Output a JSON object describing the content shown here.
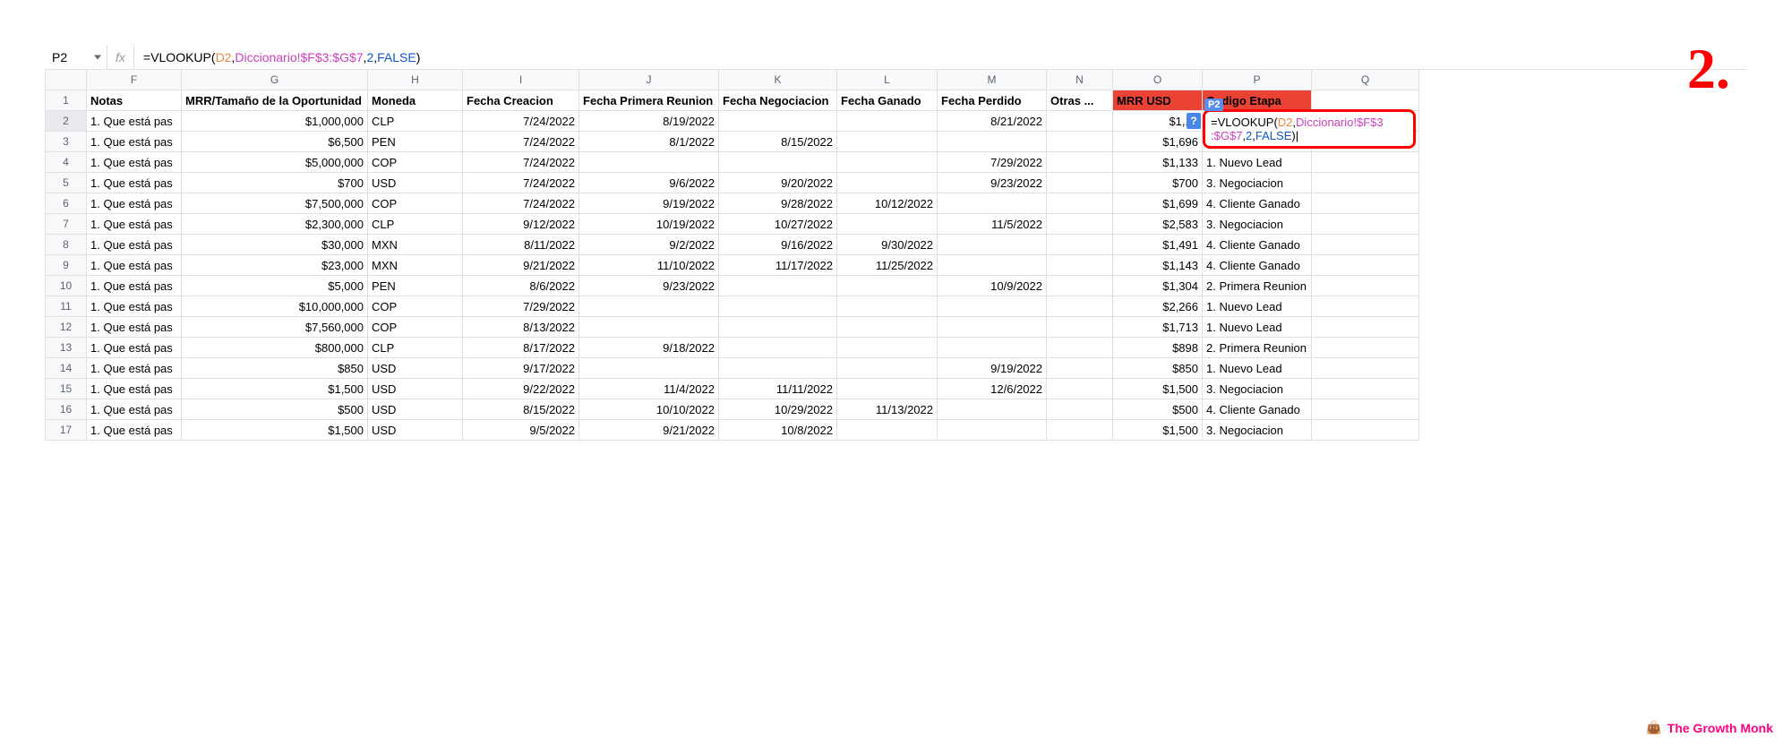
{
  "annotation": {
    "step_label": "2."
  },
  "name_box": {
    "value": "P2"
  },
  "formula_bar": {
    "fx": "fx",
    "parts": {
      "eq": "=",
      "fn": "VLOOKUP",
      "open": "(",
      "ref1": "D2",
      "c1": ",",
      "ref2": "Diccionario!$F$3:$G$7",
      "c2": ",",
      "num": "2",
      "c3": ",",
      "bool": "FALSE",
      "close": ")"
    }
  },
  "columns": [
    "F",
    "G",
    "H",
    "I",
    "J",
    "K",
    "L",
    "M",
    "N",
    "O",
    "P",
    "Q"
  ],
  "headers": {
    "F": "Notas",
    "G": "MRR/Tamaño de la Oportunidad",
    "H": "Moneda",
    "I": "Fecha Creacion",
    "J": "Fecha Primera Reunion",
    "K": "Fecha Negociacion",
    "L": "Fecha Ganado",
    "M": "Fecha Perdido",
    "N": "Otras ...",
    "O": "MRR USD",
    "P": "Codigo Etapa",
    "Q": ""
  },
  "rows": [
    {
      "r": 2,
      "F": "1. Que está pas",
      "G": "$1,000,000",
      "H": "CLP",
      "I": "7/24/2022",
      "J": "8/19/2022",
      "K": "",
      "L": "",
      "M": "8/21/2022",
      "N": "",
      "O": "$1,12",
      "P": ""
    },
    {
      "r": 3,
      "F": "1. Que está pas",
      "G": "$6,500",
      "H": "PEN",
      "I": "7/24/2022",
      "J": "8/1/2022",
      "K": "8/15/2022",
      "L": "",
      "M": "",
      "N": "",
      "O": "$1,696",
      "P": ""
    },
    {
      "r": 4,
      "F": "1. Que está pas",
      "G": "$5,000,000",
      "H": "COP",
      "I": "7/24/2022",
      "J": "",
      "K": "",
      "L": "",
      "M": "7/29/2022",
      "N": "",
      "O": "$1,133",
      "P": "1. Nuevo Lead"
    },
    {
      "r": 5,
      "F": "1. Que está pas",
      "G": "$700",
      "H": "USD",
      "I": "7/24/2022",
      "J": "9/6/2022",
      "K": "9/20/2022",
      "L": "",
      "M": "9/23/2022",
      "N": "",
      "O": "$700",
      "P": "3. Negociacion"
    },
    {
      "r": 6,
      "F": "1. Que está pas",
      "G": "$7,500,000",
      "H": "COP",
      "I": "7/24/2022",
      "J": "9/19/2022",
      "K": "9/28/2022",
      "L": "10/12/2022",
      "M": "",
      "N": "",
      "O": "$1,699",
      "P": "4. Cliente Ganado"
    },
    {
      "r": 7,
      "F": "1. Que está pas",
      "G": "$2,300,000",
      "H": "CLP",
      "I": "9/12/2022",
      "J": "10/19/2022",
      "K": "10/27/2022",
      "L": "",
      "M": "11/5/2022",
      "N": "",
      "O": "$2,583",
      "P": "3. Negociacion"
    },
    {
      "r": 8,
      "F": "1. Que está pas",
      "G": "$30,000",
      "H": "MXN",
      "I": "8/11/2022",
      "J": "9/2/2022",
      "K": "9/16/2022",
      "L": "9/30/2022",
      "M": "",
      "N": "",
      "O": "$1,491",
      "P": "4. Cliente Ganado"
    },
    {
      "r": 9,
      "F": "1. Que está pas",
      "G": "$23,000",
      "H": "MXN",
      "I": "9/21/2022",
      "J": "11/10/2022",
      "K": "11/17/2022",
      "L": "11/25/2022",
      "M": "",
      "N": "",
      "O": "$1,143",
      "P": "4. Cliente Ganado"
    },
    {
      "r": 10,
      "F": "1. Que está pas",
      "G": "$5,000",
      "H": "PEN",
      "I": "8/6/2022",
      "J": "9/23/2022",
      "K": "",
      "L": "",
      "M": "10/9/2022",
      "N": "",
      "O": "$1,304",
      "P": "2. Primera Reunion"
    },
    {
      "r": 11,
      "F": "1. Que está pas",
      "G": "$10,000,000",
      "H": "COP",
      "I": "7/29/2022",
      "J": "",
      "K": "",
      "L": "",
      "M": "",
      "N": "",
      "O": "$2,266",
      "P": "1. Nuevo Lead"
    },
    {
      "r": 12,
      "F": "1. Que está pas",
      "G": "$7,560,000",
      "H": "COP",
      "I": "8/13/2022",
      "J": "",
      "K": "",
      "L": "",
      "M": "",
      "N": "",
      "O": "$1,713",
      "P": "1. Nuevo Lead"
    },
    {
      "r": 13,
      "F": "1. Que está pas",
      "G": "$800,000",
      "H": "CLP",
      "I": "8/17/2022",
      "J": "9/18/2022",
      "K": "",
      "L": "",
      "M": "",
      "N": "",
      "O": "$898",
      "P": "2. Primera Reunion"
    },
    {
      "r": 14,
      "F": "1. Que está pas",
      "G": "$850",
      "H": "USD",
      "I": "9/17/2022",
      "J": "",
      "K": "",
      "L": "",
      "M": "9/19/2022",
      "N": "",
      "O": "$850",
      "P": "1. Nuevo Lead"
    },
    {
      "r": 15,
      "F": "1. Que está pas",
      "G": "$1,500",
      "H": "USD",
      "I": "9/22/2022",
      "J": "11/4/2022",
      "K": "11/11/2022",
      "L": "",
      "M": "12/6/2022",
      "N": "",
      "O": "$1,500",
      "P": "3. Negociacion"
    },
    {
      "r": 16,
      "F": "1. Que está pas",
      "G": "$500",
      "H": "USD",
      "I": "8/15/2022",
      "J": "10/10/2022",
      "K": "10/29/2022",
      "L": "11/13/2022",
      "M": "",
      "N": "",
      "O": "$500",
      "P": "4. Cliente Ganado"
    },
    {
      "r": 17,
      "F": "1. Que está pas",
      "G": "$1,500",
      "H": "USD",
      "I": "9/5/2022",
      "J": "9/21/2022",
      "K": "10/8/2022",
      "L": "",
      "M": "",
      "N": "",
      "O": "$1,500",
      "P": "3. Negociacion"
    }
  ],
  "active_cell": {
    "chip": "P2",
    "hint": "?",
    "formula_parts": {
      "line1_eq": "=",
      "line1_fn": "VLOOKUP",
      "line1_open": "(",
      "line1_ref1": "D2",
      "line1_c": ",",
      "line1_ref2a": "Diccionario!$F$3",
      "line2_ref2b": ":$G$7",
      "line2_c1": ",",
      "line2_num": "2",
      "line2_c2": ",",
      "line2_bool": "FALSE",
      "line2_close": ")"
    }
  },
  "watermark": {
    "icon": "👜",
    "text": "The Growth Monk"
  }
}
